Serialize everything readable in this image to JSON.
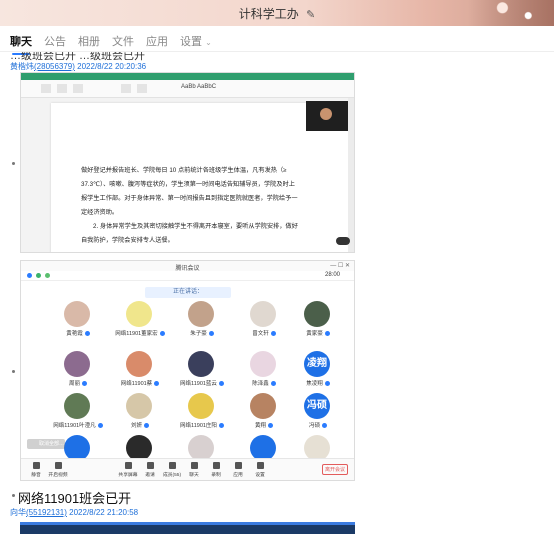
{
  "window": {
    "title": "计科学工办"
  },
  "tabs": [
    {
      "label": "聊天",
      "active": true
    },
    {
      "label": "公告",
      "active": false
    },
    {
      "label": "相册",
      "active": false
    },
    {
      "label": "文件",
      "active": false
    },
    {
      "label": "应用",
      "active": false
    },
    {
      "label": "设置",
      "active": false
    }
  ],
  "feed": {
    "prev_text": "…级班会已开 …级班会已开",
    "post1": {
      "user": "黄楷炜",
      "uid": "(28056379)",
      "time": "2022/8/22 20:20:36"
    },
    "doc": {
      "style_label": "AaBb AaBbC",
      "lines": [
        "做好登记并报告班长、学院每日 10 点前统计各班级学生体温，凡有发热（≥",
        "37.3℃）、咳嗽、腹泻等症状的，学生须第一时间电话告知辅导员，学院及时上",
        "报学生工作部。对于身体异常、第一时间报告且到指定医院就医者，学院给予一",
        "定经济资助。",
        "2. 身体异常学生及其密切接触学生不得离开本寝室，要听从学院安排，做好",
        "自我防护，学院会安排专人送餐。"
      ]
    },
    "meeting": {
      "title": "腾讯会议",
      "clock": "28:00",
      "window_controls": "—  ☐  ✕",
      "speaking": "正在讲话：",
      "participants": [
        {
          "name": "黄艳霞",
          "color": "#d9b9a8"
        },
        {
          "name": "网络11901董家宏",
          "color": "#f0e68c"
        },
        {
          "name": "朱子豪",
          "color": "#c2a28b"
        },
        {
          "name": "曾文轩",
          "color": "#e0d8d0"
        },
        {
          "name": "黄家豪",
          "color": "#4b5f4a"
        },
        {
          "name": "周丽",
          "color": "#8c6b8f"
        },
        {
          "name": "网络11901蔡",
          "color": "#d98b6a"
        },
        {
          "name": "网络11901蓝云",
          "color": "#3a3f5c"
        },
        {
          "name": "陈泽鑫",
          "color": "#e9d6e1"
        },
        {
          "name": "焦凌翔",
          "text": "凌翔"
        },
        {
          "name": "网络11901叶澄凡",
          "color": "#607a55"
        },
        {
          "name": "刘妍",
          "color": "#d6c7a8"
        },
        {
          "name": "网络11901庄阳",
          "color": "#e7c84c"
        },
        {
          "name": "黄翔",
          "color": "#b78362"
        },
        {
          "name": "冯硕",
          "text": "冯硕"
        },
        {
          "name": "",
          "color": "#1e70e6"
        },
        {
          "name": "",
          "color": "#2a2a2a"
        },
        {
          "name": "",
          "color": "#d8d0d0"
        },
        {
          "name": "",
          "color": "#1e70e6"
        },
        {
          "name": "",
          "color": "#e6e0d4"
        }
      ],
      "overlay_label": "取消全部…",
      "toolbar": [
        "静音",
        "开启视频",
        "共享屏幕",
        "邀请",
        "成员(55)",
        "聊天",
        "录制",
        "应用",
        "设置"
      ],
      "leave_label": "离开会议"
    },
    "message_title": "网络11901班会已开",
    "post2": {
      "user": "向华",
      "uid": "(55192131)",
      "time": "2022/8/22 21:20:58"
    }
  },
  "colors": {
    "accent": "#2b7cff",
    "link": "#1e6fd8"
  }
}
